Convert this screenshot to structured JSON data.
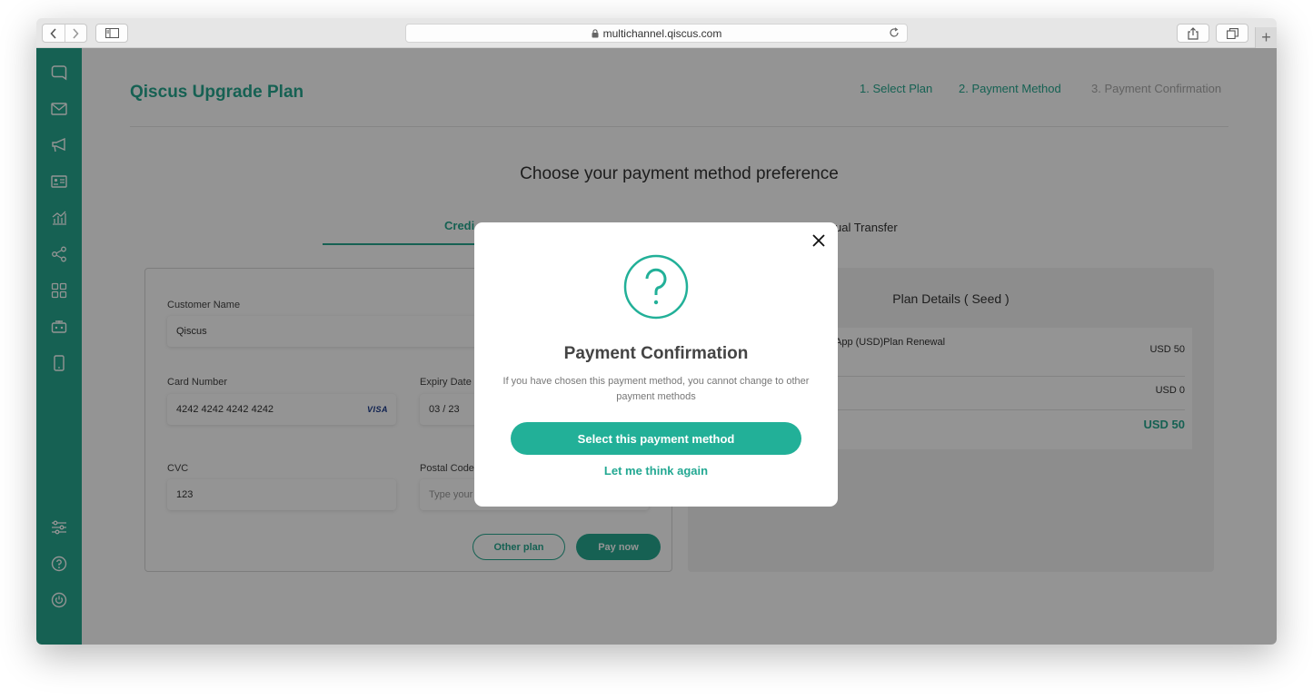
{
  "browser": {
    "url": "multichannel.qiscus.com"
  },
  "header": {
    "title": "Qiscus Upgrade Plan",
    "steps": [
      {
        "label": "1. Select Plan",
        "state": "done"
      },
      {
        "label": "2. Payment Method",
        "state": "active"
      },
      {
        "label": "3. Payment Confirmation",
        "state": "pending"
      }
    ]
  },
  "page": {
    "heading": "Choose your payment method preference",
    "tabs": [
      {
        "label": "Credi",
        "active": true
      },
      {
        "label": "ual Transfer",
        "active": false
      }
    ]
  },
  "form": {
    "customer_name_label": "Customer Name",
    "customer_name_value": "Qiscus",
    "card_number_label": "Card Number",
    "card_number_value": "4242 4242 4242 4242",
    "card_brand": "VISA",
    "expiry_label": "Expiry Date",
    "expiry_value": "03 / 23",
    "cvc_label": "CVC",
    "cvc_value": "123",
    "postal_label": "Postal Code",
    "postal_placeholder": "Type your postal code",
    "other_plan_label": "Other plan",
    "pay_now_label": "Pay now"
  },
  "plan": {
    "title": "Plan Details ( Seed )",
    "rows": [
      {
        "label": "App (USD)Plan Renewal",
        "value": "USD 50"
      },
      {
        "label": "",
        "value": "USD 0"
      },
      {
        "label": "",
        "value": "USD 50"
      }
    ]
  },
  "modal": {
    "icon": "question-mark-icon",
    "title": "Payment Confirmation",
    "description": "If you have chosen this payment method, you cannot change to other payment methods",
    "primary_label": "Select this payment method",
    "secondary_label": "Let me think again"
  },
  "colors": {
    "brand": "#26a88f",
    "button": "#22b098"
  },
  "sidebar_icons": [
    "chat-icon",
    "mail-icon",
    "megaphone-icon",
    "contact-card-icon",
    "analytics-icon",
    "share-icon",
    "apps-grid-icon",
    "bot-icon",
    "mobile-icon",
    "settings-sliders-icon",
    "help-icon",
    "power-icon"
  ]
}
